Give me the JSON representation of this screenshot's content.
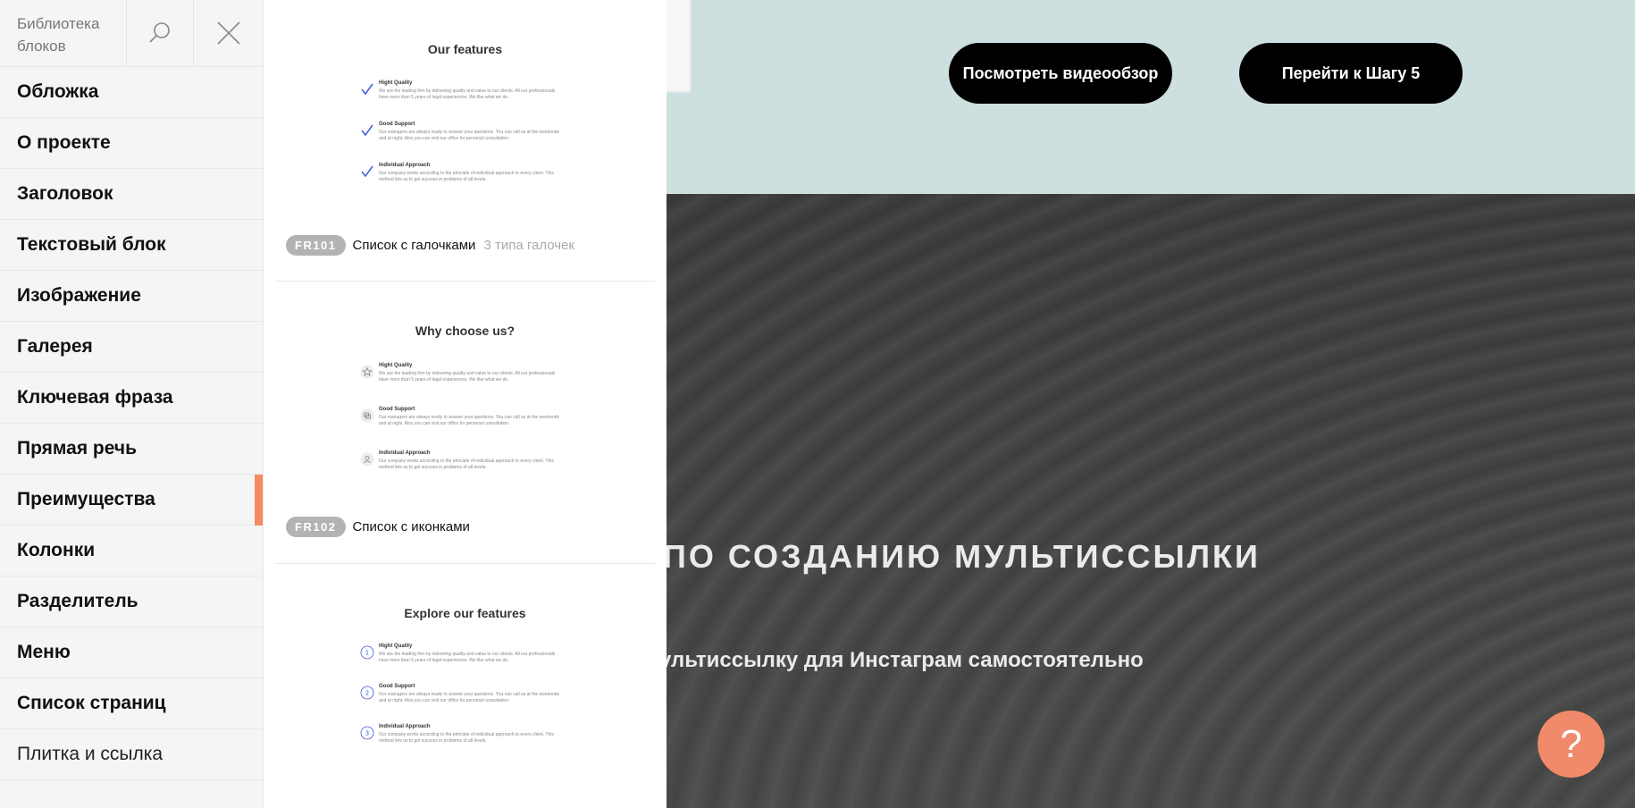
{
  "sidebar": {
    "title": "Библиотека блоков",
    "items": [
      {
        "label": "Обложка"
      },
      {
        "label": "О проекте"
      },
      {
        "label": "Заголовок"
      },
      {
        "label": "Текстовый блок"
      },
      {
        "label": "Изображение"
      },
      {
        "label": "Галерея"
      },
      {
        "label": "Ключевая фраза"
      },
      {
        "label": "Прямая речь"
      },
      {
        "label": "Преимущества",
        "active": true
      },
      {
        "label": "Колонки"
      },
      {
        "label": "Разделитель"
      },
      {
        "label": "Меню"
      },
      {
        "label": "Список страниц"
      },
      {
        "label": "Плитка и ссылка"
      }
    ]
  },
  "gallery": {
    "cards": [
      {
        "preview_title": "Our features",
        "icon_style": "checkmark",
        "features": [
          {
            "name": "Hight Quality",
            "text": "We are the leading firm by delivering quality and value to our clients. All our professionals have more than 5 years of legal experiences. We like what we do."
          },
          {
            "name": "Good Support",
            "text": "Our managers are always ready to answer your questions. You can call us at the weekends and at night. Also you can visit our office for personal consultation."
          },
          {
            "name": "Individual Approach",
            "text": "Our company works according to the principle of individual approach to every client. This method lets us to get success in problems of all levels."
          }
        ],
        "code": "FR101",
        "name": "Список с галочками",
        "note": "3 типа галочек"
      },
      {
        "preview_title": "Why choose us?",
        "icon_style": "circle-icons",
        "features": [
          {
            "name": "Hight Quality",
            "text": "We are the leading firm by delivering quality and value to our clients. All our professionals have more than 5 years of legal experiences. We like what we do."
          },
          {
            "name": "Good Support",
            "text": "Our managers are always ready to answer your questions. You can call us at the weekends and at night. Also you can visit our office for personal consultation."
          },
          {
            "name": "Individual Approach",
            "text": "Our company works according to the principle of individual approach to every client. This method lets us to get success in problems of all levels."
          }
        ],
        "code": "FR102",
        "name": "Список с иконками",
        "note": ""
      },
      {
        "preview_title": "Explore our features",
        "icon_style": "numbers",
        "features": [
          {
            "name": "Hight Quality",
            "number": "1",
            "text": "We are the leading firm by delivering quality and value to our clients. All our professionals have more than 5 years of legal experiences. We like what we do."
          },
          {
            "name": "Good Support",
            "number": "2",
            "text": "Our managers are always ready to answer your questions. You can call us at the weekends and at night. Also you can visit our office for personal consultation."
          },
          {
            "name": "Individual Approach",
            "number": "3",
            "text": "Our company works according to the principle of individual approach to every client. This method lets us to get success in problems of all levels."
          }
        ]
      }
    ]
  },
  "page": {
    "video_button": "Посмотреть видеообзор",
    "step_button": "Перейти к Шагу 5",
    "hero_title": "ПО СОЗДАНИЮ МУЛЬТИССЫЛКИ",
    "hero_subtitle": "ультиссылку для Инстаграм самостоятельно",
    "help_label": "?"
  },
  "colors": {
    "accent": "#f58a63",
    "help_button": "#f08a6a",
    "top_section": "#cddfdf",
    "tag": "#b3b3b3",
    "checkmark": "#3d5bd9"
  }
}
